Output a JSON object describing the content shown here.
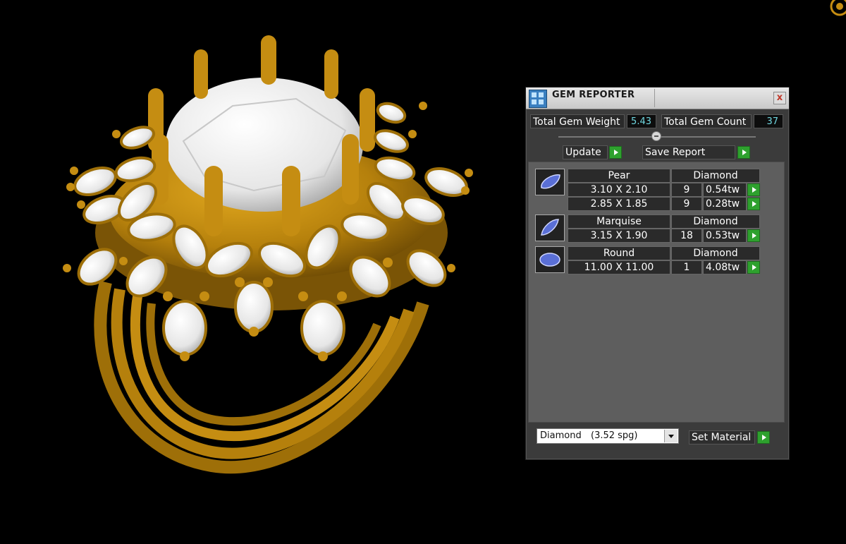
{
  "panel": {
    "title": "GEM REPORTER",
    "close_label": "x"
  },
  "totals": {
    "weight_label": "Total Gem Weight",
    "weight_value": "5.43",
    "count_label": "Total Gem Count",
    "count_value": "37"
  },
  "actions": {
    "update_label": "Update",
    "save_report_label": "Save Report"
  },
  "gem_groups": [
    {
      "shape": "Pear",
      "material": "Diamond",
      "rows": [
        {
          "size": "3.10 X 2.10",
          "count": "9",
          "weight": "0.54tw"
        },
        {
          "size": "2.85 X 1.85",
          "count": "9",
          "weight": "0.28tw"
        }
      ]
    },
    {
      "shape": "Marquise",
      "material": "Diamond",
      "rows": [
        {
          "size": "3.15 X 1.90",
          "count": "18",
          "weight": "0.53tw"
        }
      ]
    },
    {
      "shape": "Round",
      "material": "Diamond",
      "rows": [
        {
          "size": "11.00 X 11.00",
          "count": "1",
          "weight": "4.08tw"
        }
      ]
    }
  ],
  "material": {
    "selected_name": "Diamond",
    "selected_spg": "(3.52 spg)",
    "set_label": "Set Material"
  },
  "colors": {
    "panel_bg": "#3b3b3b",
    "value_text": "#6fd7e0",
    "go_button": "#2ea12e",
    "gold": "#b8860b",
    "gem_white": "#f2f2f2"
  }
}
